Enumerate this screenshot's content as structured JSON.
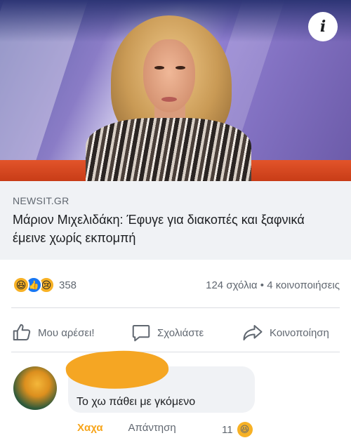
{
  "link_preview": {
    "source": "NEWSIT.GR",
    "headline": "Μάριον Μιχελιδάκη: Έφυγε για διακοπές και ξαφνικά έμεινε χωρίς εκπομπή",
    "info_icon": "info-icon"
  },
  "reactions": {
    "types": [
      "haha",
      "like",
      "sad"
    ],
    "count": "358",
    "comments_shares": "124 σχόλια • 4 κοινοποιήσεις"
  },
  "actions": {
    "like": "Μου αρέσει!",
    "comment": "Σχολιάστε",
    "share": "Κοινοποίηση"
  },
  "comment": {
    "author": "",
    "text": "Το χω πάθει με γκόμενο",
    "reaction_label": "Χαχα",
    "reply_label": "Απάντηση",
    "reaction_count": "11"
  },
  "colors": {
    "accent_blue": "#1877f2",
    "haha_yellow": "#f7b125",
    "redaction_orange": "#f5a623",
    "link_box_bg": "#f0f2f5"
  }
}
